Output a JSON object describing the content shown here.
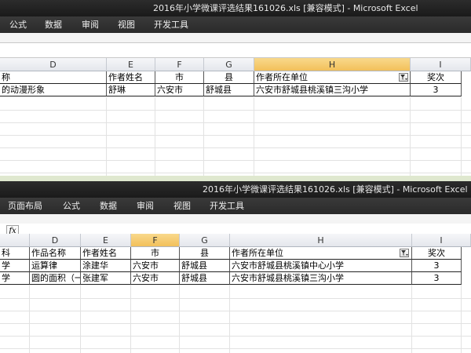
{
  "top_window": {
    "title": "2016年小学微课评选结果161026.xls  [兼容模式]  -  Microsoft Excel",
    "ribbon_tabs": [
      "公式",
      "数据",
      "审阅",
      "视图",
      "开发工具"
    ],
    "columns": [
      "D",
      "E",
      "F",
      "G",
      "H",
      "I"
    ],
    "headers": {
      "d": "称",
      "e": "作者姓名",
      "f": "市",
      "g": "县",
      "h": "作者所在单位",
      "i": "奖次"
    },
    "rows": [
      {
        "d": "的动漫形象",
        "e": "舒琳",
        "f": "六安市",
        "g": "舒城县",
        "h": "六安市舒城县桃溪镇三沟小学",
        "i": "3"
      }
    ]
  },
  "bottom_window": {
    "title": "2016年小学微课评选结果161026.xls  [兼容模式]  -  Microsoft Excel",
    "ribbon_tabs": [
      "页面布局",
      "公式",
      "数据",
      "审阅",
      "视图",
      "开发工具"
    ],
    "fx_label": "fx",
    "columns": [
      "D",
      "E",
      "F",
      "G",
      "H",
      "I"
    ],
    "headers": {
      "c": "科",
      "d": "作品名称",
      "e": "作者姓名",
      "f": "市",
      "g": "县",
      "h": "作者所在单位",
      "i": "奖次"
    },
    "rows": [
      {
        "c": "学",
        "d": "运算律",
        "e": "涂建华",
        "f": "六安市",
        "g": "舒城县",
        "h": "六安市舒城县桃溪镇中心小学",
        "i": "3"
      },
      {
        "c": "学",
        "d": "圆的面积（一",
        "e": "张建军",
        "f": "六安市",
        "g": "舒城县",
        "h": "六安市舒城县桃溪镇三沟小学",
        "i": "3"
      }
    ]
  },
  "colors": {
    "title_bg": "#1f1f1f",
    "selected_col_header": "#f5c766",
    "frame": "#dfe8cf"
  }
}
